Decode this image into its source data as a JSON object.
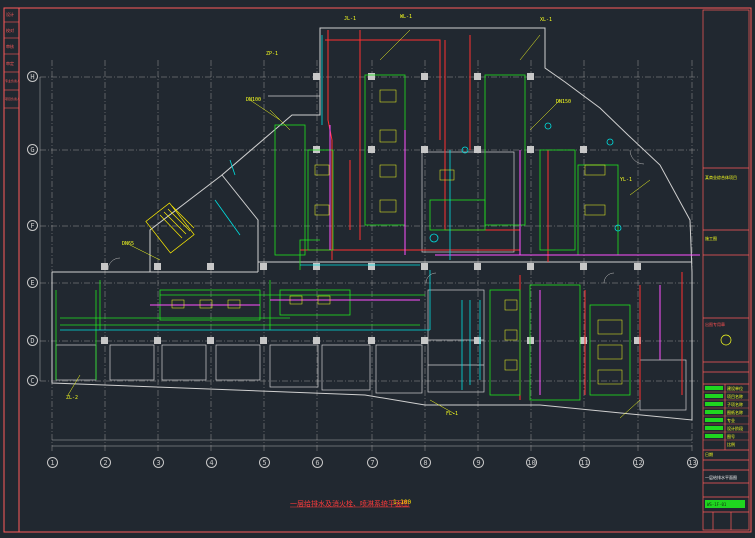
{
  "sheet_title": "一层给排水及消火栓、喷淋系统平面图",
  "sheet_scale": "1:100",
  "axis_columns": [
    "1",
    "2",
    "3",
    "4",
    "5",
    "6",
    "7",
    "8",
    "9",
    "10",
    "11",
    "12",
    "13",
    "14"
  ],
  "axis_rows": [
    "H",
    "G",
    "F",
    "E",
    "D",
    "C",
    "B"
  ],
  "left_strip": [
    "设计",
    "校对",
    "审核",
    "审定",
    "专业负责人",
    "项目负责人"
  ],
  "title_block": {
    "project": "某商业综合体项目",
    "drawing_name": "一层给排水平面图",
    "drawing_no": "WS-1F-01",
    "stage": "施工图",
    "stamp_note": "出图专用章",
    "rows": [
      "建设单位",
      "项目名称",
      "子项名称",
      "图纸名称",
      "专业",
      "设计阶段",
      "图号",
      "比例",
      "日期"
    ]
  },
  "equipment_tags": [
    "JL-1",
    "WL-1",
    "XL-1",
    "ZP-1",
    "DN100",
    "DN150",
    "DN65",
    "ZL-2",
    "FL-1",
    "YL-1"
  ],
  "colors": {
    "background": "#212830",
    "frame": "#ff5a5a",
    "wall": "#c8c8c8",
    "hot_water": "#ff3030",
    "sprinkler": "#1fe41f",
    "fire_hydrant": "#ff50ff",
    "supply": "#00e0e0",
    "annotation": "#f7ff1e"
  }
}
